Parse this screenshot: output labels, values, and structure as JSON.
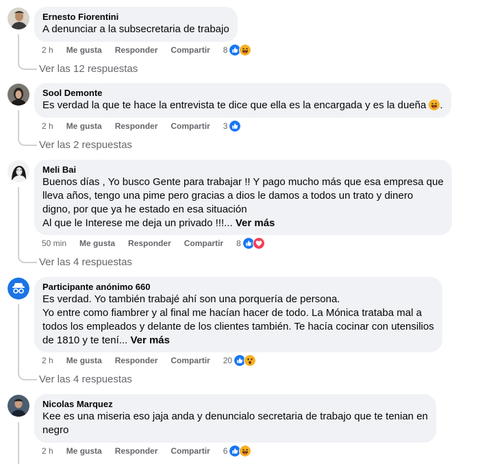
{
  "actions": {
    "like": "Me gusta",
    "reply": "Responder",
    "share": "Compartir"
  },
  "comments": [
    {
      "author": "Ernesto Fiorentini",
      "text": "A denunciar a la subsecretaria de trabajo",
      "time": "2 h",
      "reaction_count": "8",
      "reactions": [
        "like-icon",
        "haha-icon"
      ],
      "replies": "Ver las 12 respuestas"
    },
    {
      "author": "Sool Demonte",
      "text": "Es verdad la que te hace la entrevista te dice que ella es la encargada y es la dueña",
      "text_suffix": ".",
      "time": "2 h",
      "reaction_count": "3",
      "reactions": [
        "like-icon"
      ],
      "replies": "Ver las 2 respuestas"
    },
    {
      "author": "Meli Bai",
      "text": "Buenos días , Yo busco Gente para trabajar !! Y pago mucho más que esa empresa que\nlleva años, tengo una pime pero gracias a dios le damos a todos un trato y dinero\ndigno, por que ya he estado en esa situación\nAl que le Interese me deja un privado !!!... ",
      "see_more": "Ver más",
      "time": "50 min",
      "reaction_count": "8",
      "reactions": [
        "like-icon",
        "love-icon"
      ],
      "replies": "Ver las 4 respuestas"
    },
    {
      "author": "Participante anónimo 660",
      "text": "Es verdad. Yo también trabajé ahí son una porquería de persona.\nYo entre como fiambrer y al final me hacían hacer de todo. La Mónica trataba mal a\ntodos los empleados y delante de los clientes también. Te hacía cocinar con utensilios\nde 1810 y te tení... ",
      "see_more": "Ver más",
      "time": "2 h",
      "reaction_count": "20",
      "reactions": [
        "like-icon",
        "wow-icon"
      ],
      "replies": "Ver las 4 respuestas"
    },
    {
      "author": "Nicolas Marquez",
      "text": "Kee es una miseria eso jaja anda y denuncialo secretaria de trabajo que te tenian en\nnegro",
      "time": "2 h",
      "reaction_count": "6",
      "reactions": [
        "like-icon",
        "haha-icon"
      ]
    }
  ]
}
